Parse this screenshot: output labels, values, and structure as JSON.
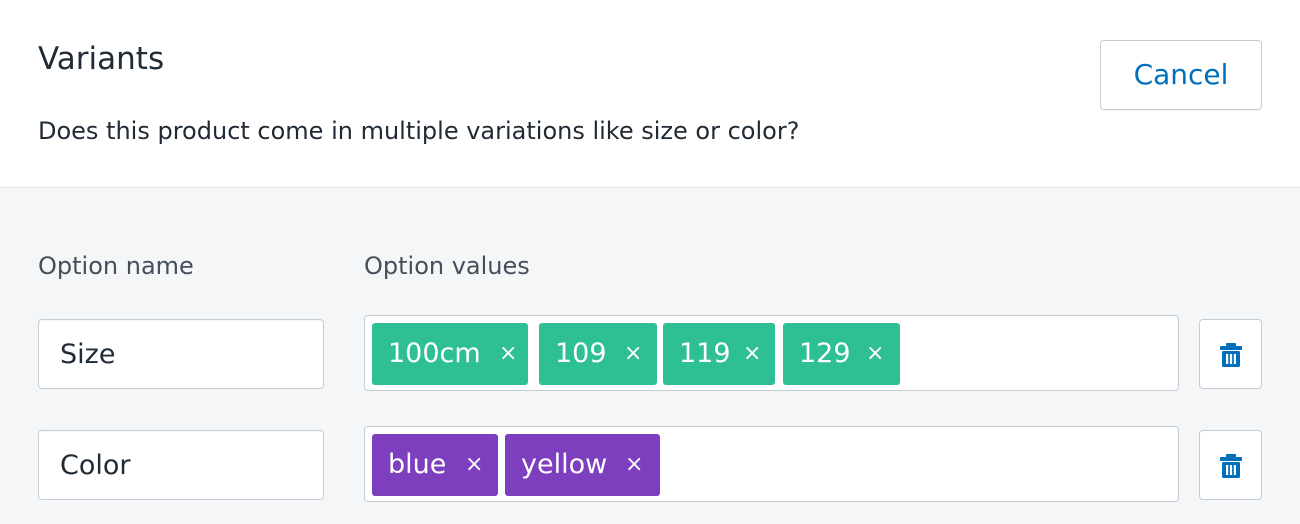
{
  "header": {
    "title": "Variants",
    "subtitle": "Does this product come in multiple variations like size or color?",
    "cancel_label": "Cancel"
  },
  "columns": {
    "option_name_label": "Option name",
    "option_values_label": "Option values"
  },
  "options": [
    {
      "name": "Size",
      "tag_color": "#2fbf94",
      "values": [
        "100cm",
        "109",
        "119",
        "129"
      ]
    },
    {
      "name": "Color",
      "tag_color": "#7e3fbf",
      "values": [
        "blue",
        "yellow"
      ]
    }
  ],
  "icons": {
    "remove_tag": "×",
    "delete_option": "trash-icon"
  },
  "colors": {
    "accent": "#006fbb",
    "border": "#c4cdd5",
    "section_bg": "#f4f6f8"
  }
}
